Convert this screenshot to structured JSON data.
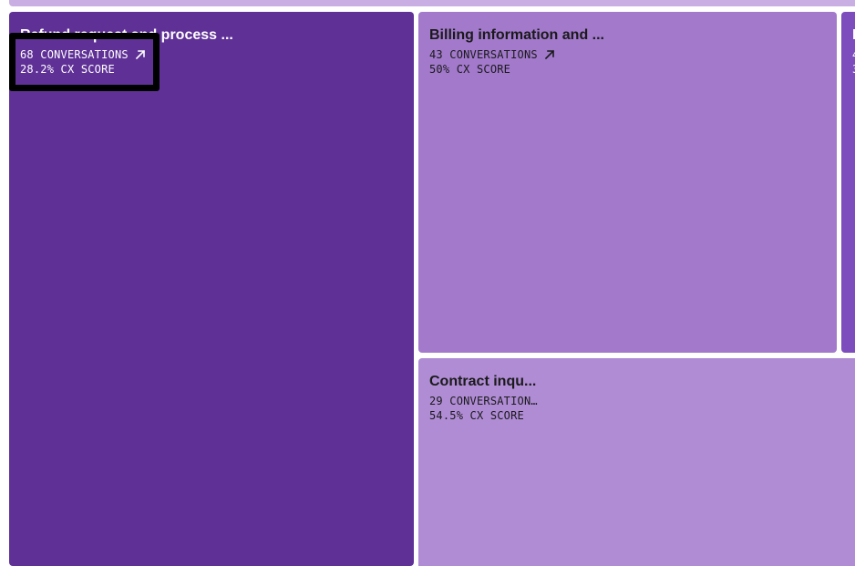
{
  "treemap": {
    "tiles": [
      {
        "id": "refund",
        "title": "Refund request and process ...",
        "conversations": "68 CONVERSATIONS",
        "cx_score": "28.2% CX SCORE",
        "color": "#5f3096",
        "has_link_icon": true
      },
      {
        "id": "billing",
        "title": "Billing information and ...",
        "conversations": "43 CONVERSATIONS",
        "cx_score": "50% CX SCORE",
        "color": "#a279cb",
        "has_link_icon": true
      },
      {
        "id": "contract",
        "title": "Contract inqu...",
        "conversations": "29 CONVERSATION…",
        "cx_score": "54.5% CX SCORE",
        "color": "#b08cd5",
        "has_link_icon": false
      },
      {
        "id": "right-partial",
        "title": "I",
        "conversations": "4",
        "cx_score": "3",
        "color": "#7d4cbd",
        "has_link_icon": false
      }
    ],
    "top_strip_color": "#c9aee3",
    "highlight_color": "#000000"
  },
  "icons": {
    "external_link": "arrow-up-right-icon"
  }
}
